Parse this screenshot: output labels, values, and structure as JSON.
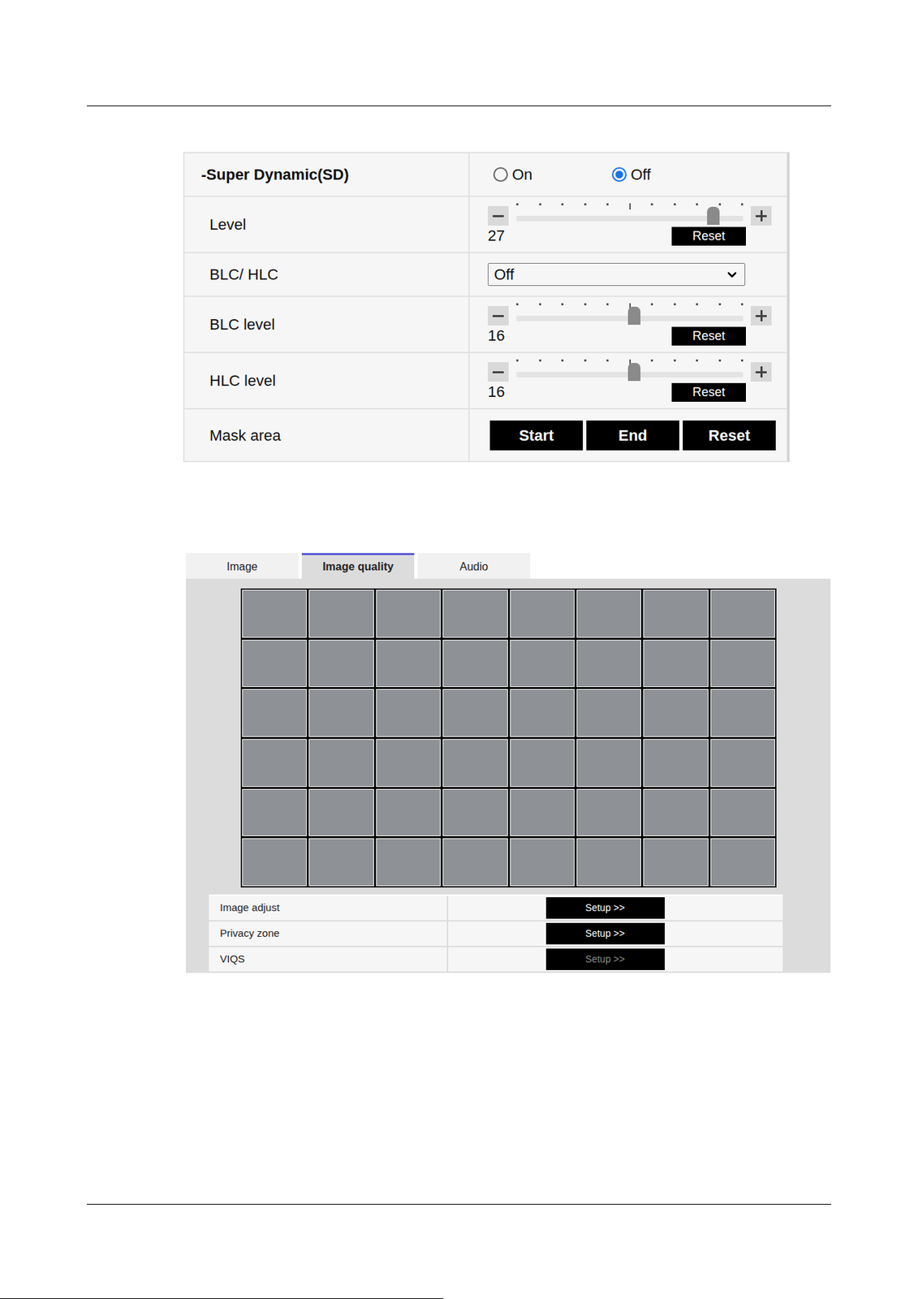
{
  "settings": {
    "super_dynamic": {
      "label": "-Super Dynamic(SD)",
      "options": [
        {
          "label": "On",
          "selected": false
        },
        {
          "label": "Off",
          "selected": true
        }
      ]
    },
    "level": {
      "label": "Level",
      "value": "27",
      "level": 0.87,
      "reset": "Reset"
    },
    "blc_hlc": {
      "label": "BLC/ HLC",
      "value": "Off"
    },
    "blc_level": {
      "label": "BLC level",
      "value": "16",
      "level": 0.52,
      "reset": "Reset"
    },
    "hlc_level": {
      "label": "HLC level",
      "value": "16",
      "level": 0.52,
      "reset": "Reset"
    },
    "mask_area": {
      "label": "Mask area",
      "buttons": [
        "Start",
        "End",
        "Reset"
      ]
    }
  },
  "tabs": [
    {
      "label": "Image",
      "selected": false
    },
    {
      "label": "Image quality",
      "selected": true
    },
    {
      "label": "Audio",
      "selected": false
    }
  ],
  "setup_rows": [
    {
      "label": "Image adjust",
      "button": "Setup >>",
      "disabled": false
    },
    {
      "label": "Privacy zone",
      "button": "Setup >>",
      "disabled": false
    },
    {
      "label": "VIQS",
      "button": "Setup >>",
      "disabled": true
    }
  ]
}
